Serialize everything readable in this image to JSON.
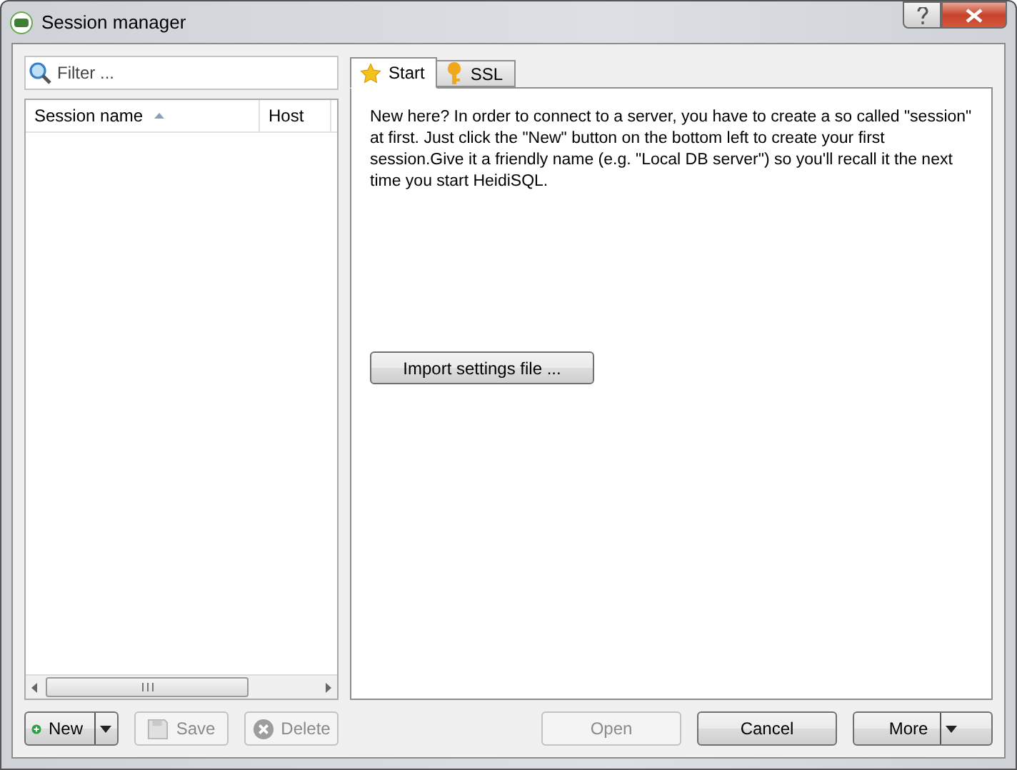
{
  "window": {
    "title": "Session manager"
  },
  "filter": {
    "placeholder": "Filter ..."
  },
  "session_list": {
    "columns": [
      {
        "label": "Session name",
        "sorted": true
      },
      {
        "label": "Host",
        "sorted": false
      }
    ]
  },
  "tabs": [
    {
      "label": "Start",
      "selected": true,
      "kind": "star"
    },
    {
      "label": "SSL",
      "selected": false,
      "kind": "key"
    }
  ],
  "start_text": "New here? In order to connect to a server, you have to create a so called \"session\" at first. Just click the \"New\" button on the bottom left to create your first session.Give it a friendly name (e.g. \"Local DB server\") so you'll recall it the next time you start HeidiSQL.",
  "import_button": "Import settings file ...",
  "left_buttons": [
    {
      "label": "New",
      "kind": "new",
      "disabled": false,
      "dropdown": true
    },
    {
      "label": "Save",
      "kind": "save",
      "disabled": true,
      "dropdown": false
    },
    {
      "label": "Delete",
      "kind": "delete",
      "disabled": true,
      "dropdown": false
    }
  ],
  "right_buttons": [
    {
      "label": "Open",
      "disabled": true,
      "dropdown": false
    },
    {
      "label": "Cancel",
      "disabled": false,
      "dropdown": false
    },
    {
      "label": "More",
      "disabled": false,
      "dropdown": true
    }
  ]
}
